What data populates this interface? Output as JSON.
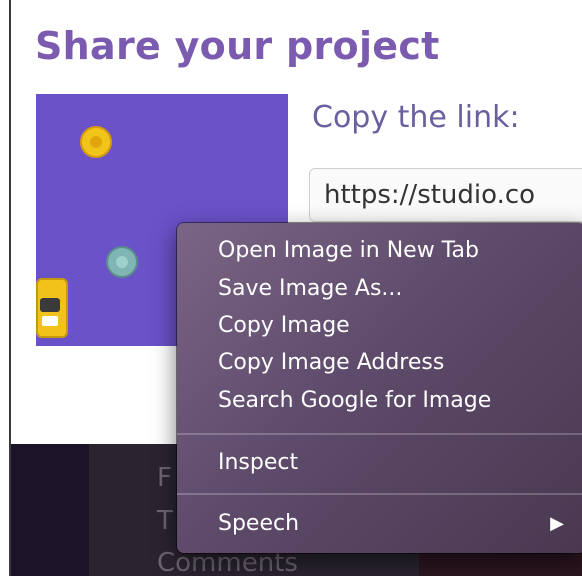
{
  "modal": {
    "title": "Share your project",
    "copy_label": "Copy the link:",
    "link_value": "https://studio.co"
  },
  "background": {
    "lines": [
      "F",
      "T",
      "Comments"
    ]
  },
  "context_menu": {
    "items": [
      {
        "label": "Open Image in New Tab"
      },
      {
        "label": "Save Image As..."
      },
      {
        "label": "Copy Image"
      },
      {
        "label": "Copy Image Address"
      },
      {
        "label": "Search Google for Image"
      }
    ],
    "inspect_label": "Inspect",
    "speech_label": "Speech",
    "speech_arrow": "▶"
  },
  "colors": {
    "accent": "#7b5bb0",
    "stage": "#6a52c8",
    "menu_bg": "#5e4a6a"
  }
}
